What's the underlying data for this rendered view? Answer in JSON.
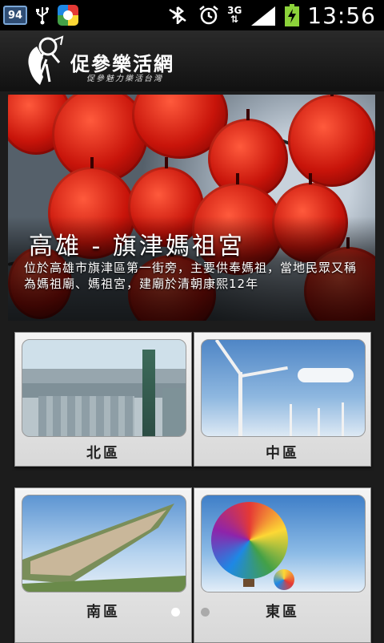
{
  "status_bar": {
    "notification_badge": "94",
    "network": "3G",
    "time": "13:56",
    "icons": [
      "usb-icon",
      "app-notification-icon",
      "bluetooth-off-icon",
      "alarm-icon",
      "network-3g-icon",
      "signal-icon",
      "battery-charging-icon"
    ]
  },
  "header": {
    "brand": "促參樂活網",
    "slogan": "促參魅力樂活台灣"
  },
  "banner": {
    "title": "高雄 - 旗津媽祖宮",
    "description": "位於高雄市旗津區第一街旁，主要供奉媽祖，當地民眾又稱為媽祖廟、媽祖宮，建廟於清朝康熙12年"
  },
  "regions": [
    {
      "label": "北區"
    },
    {
      "label": "中區"
    },
    {
      "label": "南區"
    },
    {
      "label": "東區"
    }
  ],
  "pager": {
    "count": 2,
    "active": 0
  }
}
